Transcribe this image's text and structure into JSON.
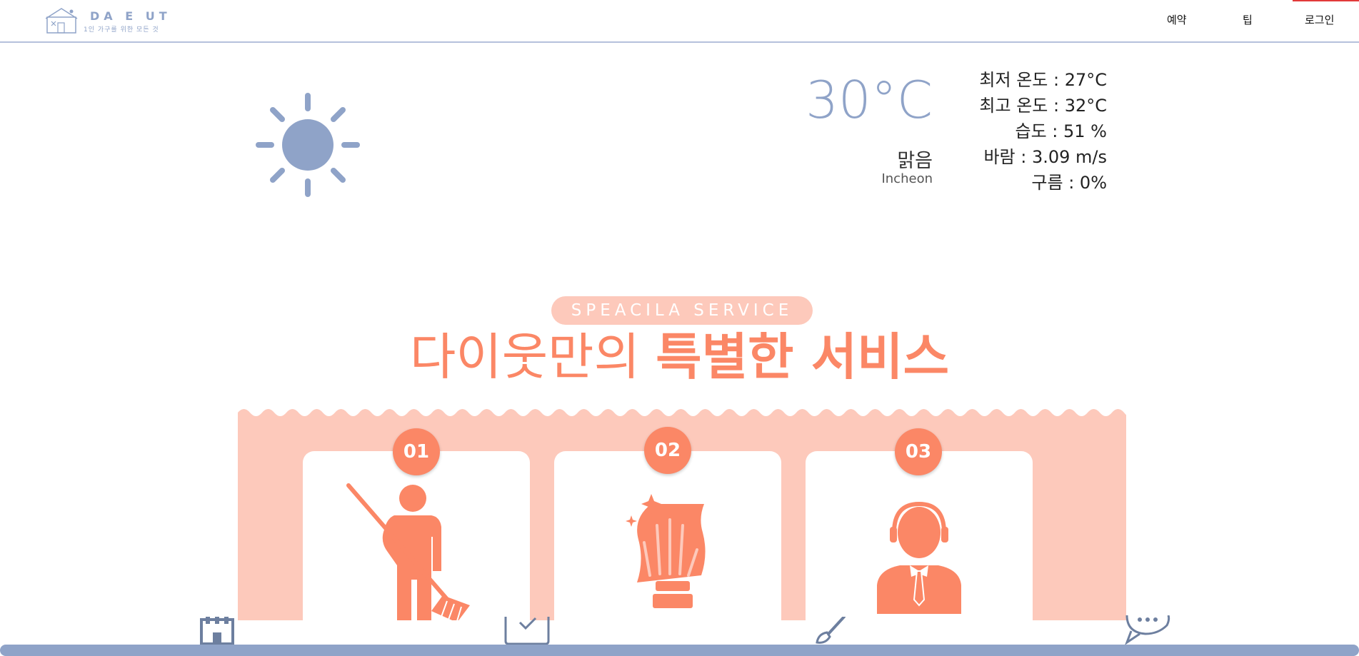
{
  "header": {
    "brand_title": "DA E UT",
    "brand_subtitle": "1인 가구를 위한 모든 것",
    "nav": [
      {
        "label": "예약"
      },
      {
        "label": "팁"
      },
      {
        "label": "로그인"
      }
    ],
    "accent": "#8fa3c8"
  },
  "weather": {
    "icon": "sun-icon",
    "temperature": "30°C",
    "condition": "맑음",
    "city": "Incheon",
    "stats": [
      "최저 온도 : 27°C",
      "최고 온도 : 32°C",
      "습도 : 51 %",
      "바람 : 3.09 m/s",
      "구름 : 0%"
    ]
  },
  "service": {
    "pill_label": "SPEACILA  SERVICE",
    "headline_light": "다이웃만의 ",
    "headline_bold": "특별한 서비스",
    "color": "#fb8766",
    "band_color": "#fdc9bb",
    "cards": [
      {
        "number": "01",
        "icon": "cleaner-sweeping-icon"
      },
      {
        "number": "02",
        "icon": "hand-wiping-icon"
      },
      {
        "number": "03",
        "icon": "customer-service-icon"
      }
    ]
  },
  "bottom_icons": [
    "building-icon",
    "checklist-icon",
    "brush-icon",
    "chat-bubble-icon"
  ]
}
